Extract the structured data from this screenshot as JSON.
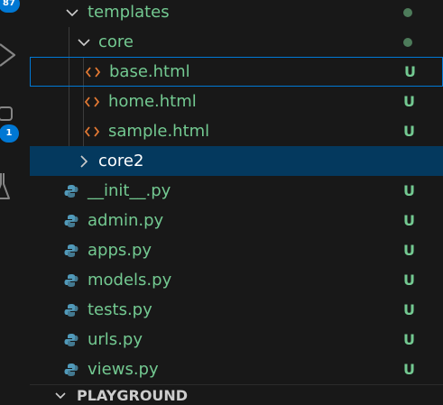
{
  "colors": {
    "background": "#181818",
    "untracked_green": "#73c991",
    "folder_text": "#73c991",
    "focus_border": "#0078d4",
    "selection": "#04395e",
    "html_icon": "#e37933",
    "python_icon": "#519aba",
    "badge_blue": "#0078d4",
    "modified_dot": "#4d7b5a"
  },
  "activity_bar": {
    "source_control_badge": "87",
    "extensions_badge": "1",
    "icons": [
      "run-debug-icon",
      "extensions-icon",
      "testing-icon"
    ]
  },
  "explorer": {
    "items": [
      {
        "label": "templates",
        "type": "folder",
        "expanded": true,
        "status": "",
        "decoration": "dot"
      },
      {
        "label": "core",
        "type": "folder",
        "expanded": true,
        "status": "",
        "decoration": "dot"
      },
      {
        "label": "base.html",
        "type": "html",
        "status": "U",
        "focused": true
      },
      {
        "label": "home.html",
        "type": "html",
        "status": "U"
      },
      {
        "label": "sample.html",
        "type": "html",
        "status": "U"
      },
      {
        "label": "core2",
        "type": "folder",
        "expanded": false,
        "status": "",
        "selected": true
      },
      {
        "label": "__init__.py",
        "type": "python",
        "status": "U"
      },
      {
        "label": "admin.py",
        "type": "python",
        "status": "U"
      },
      {
        "label": "apps.py",
        "type": "python",
        "status": "U"
      },
      {
        "label": "models.py",
        "type": "python",
        "status": "U"
      },
      {
        "label": "tests.py",
        "type": "python",
        "status": "U"
      },
      {
        "label": "urls.py",
        "type": "python",
        "status": "U"
      },
      {
        "label": "views.py",
        "type": "python",
        "status": "U"
      }
    ],
    "next_section": "PLAYGROUND"
  }
}
